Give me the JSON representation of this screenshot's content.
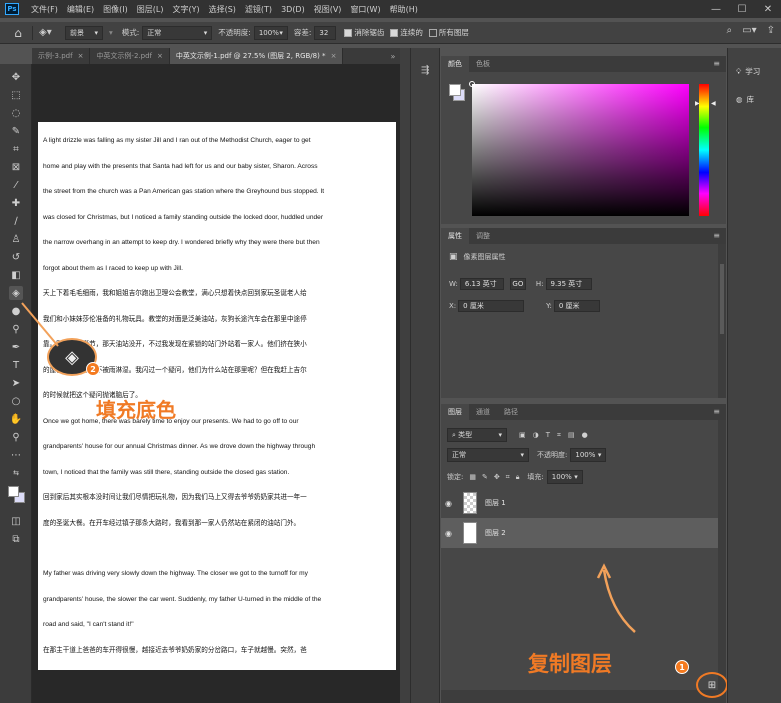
{
  "app": {
    "logo": "Ps"
  },
  "menu": [
    "文件(F)",
    "编辑(E)",
    "图像(I)",
    "图层(L)",
    "文字(Y)",
    "选择(S)",
    "滤镜(T)",
    "3D(D)",
    "视图(V)",
    "窗口(W)",
    "帮助(H)"
  ],
  "window_controls": {
    "minimize": "—",
    "restore": "☐",
    "close": "✕"
  },
  "options": {
    "fill_source": "前景",
    "mode_label": "模式:",
    "mode_value": "正常",
    "opacity_label": "不透明度:",
    "opacity_value": "100%",
    "tolerance_label": "容差:",
    "tolerance_value": "32",
    "anti_alias": "消除锯齿",
    "contiguous": "连续的",
    "all_layers": "所有图层"
  },
  "tabs": [
    {
      "label": "示例-3.pdf",
      "active": false
    },
    {
      "label": "中英文示例-2.pdf",
      "active": false
    },
    {
      "label": "中英文示例-1.pdf @ 27.5% (图层 2, RGB/8) *",
      "active": true
    }
  ],
  "tab_close": "×",
  "document": {
    "paragraphs": [
      {
        "lang": "en",
        "lines": [
          "A light drizzle was falling as my sister Jill and I ran out of the Methodist Church, eager to get",
          "home and play with the presents that Santa had left for us and our baby sister, Sharon. Across",
          "the street from the church was a Pan American gas station where the Greyhound bus stopped. It",
          "was closed for Christmas, but I noticed a family standing outside the locked door, huddled under",
          "the narrow overhang in an attempt to keep dry. I wondered briefly why they were there but then",
          "forgot about them as I raced to keep up with Jill."
        ]
      },
      {
        "lang": "zh",
        "lines": [
          "天上下着毛毛细雨，我和姐姐吉尔跑出卫理公会教堂，满心只想着快点回到家玩圣诞老人给",
          "我们和小妹妹莎伦准备的礼物玩具。教堂的对面是泛美油站，灰狗长途汽车会在那里中途停",
          "靠。因为是圣诞节，那天油站没开，不过我发现在紧锁的站门外站着一家人。他们挤在狭小",
          "的屋檐下，想尽量不被雨淋湿。我闪过一个疑问，他们为什么站在那里呢？但在我赶上吉尔",
          "的时候就把这个疑问抛诸脑后了。"
        ]
      },
      {
        "lang": "en",
        "lines": [
          "Once we got home, there was barely time to enjoy our presents. We had to go off to our",
          "grandparents' house for our annual Christmas dinner. As we drove down the highway through",
          "town, I noticed that the family was still there, standing outside the closed gas station."
        ]
      },
      {
        "lang": "zh",
        "lines": [
          "回到家后其实根本没时间让我们尽情把玩礼物，因为我们马上又得去爷爷奶奶家共进一年一",
          "度的圣诞大餐。在开车经过镇子那条大路时，我看到那一家人仍然站在紧闭的油站门外。"
        ]
      },
      {
        "lang": "gap",
        "lines": []
      },
      {
        "lang": "en",
        "lines": [
          "My father was driving very slowly down the highway. The closer we got to the turnoff for my",
          "grandparents' house, the slower the car went. Suddenly, my father U-turned in the middle of the",
          "road and said, \"I can't stand it!\""
        ]
      },
      {
        "lang": "zh",
        "lines": [
          "在那主干道上爸爸的车开得很慢，越接近去爷爷奶奶家的分岔路口，车子就越慢。突然，爸"
        ]
      }
    ]
  },
  "annotations": {
    "step2_number": "2",
    "step2_text": "填充底色",
    "step1_number": "1",
    "step1_text": "复制图层"
  },
  "color_panel": {
    "tabs": [
      "颜色",
      "色板"
    ],
    "foreground": "#ffffff",
    "background": "#dcdcf8",
    "hue": "#ff00ff"
  },
  "properties_panel": {
    "tabs": [
      "属性",
      "调整"
    ],
    "header": "像素图层属性",
    "w_label": "W:",
    "w_value": "6.13 英寸",
    "link": "GO",
    "h_label": "H:",
    "h_value": "9.35 英寸",
    "x_label": "X:",
    "x_value": "0 厘米",
    "y_label": "Y:",
    "y_value": "0 厘米"
  },
  "layers_panel": {
    "tabs": [
      "图层",
      "通道",
      "路径"
    ],
    "filter_kind": "类型",
    "blend_mode": "正常",
    "opacity_label": "不透明度:",
    "opacity_value": "100%",
    "lock_label": "锁定:",
    "fill_label": "填充:",
    "fill_value": "100%",
    "layers": [
      {
        "name": "图层 1",
        "thumb": "checker",
        "selected": false
      },
      {
        "name": "图层 2",
        "thumb": "white",
        "selected": true
      }
    ]
  },
  "far_right": {
    "learn": "学习",
    "library": "库"
  },
  "accent": "#f07a25"
}
